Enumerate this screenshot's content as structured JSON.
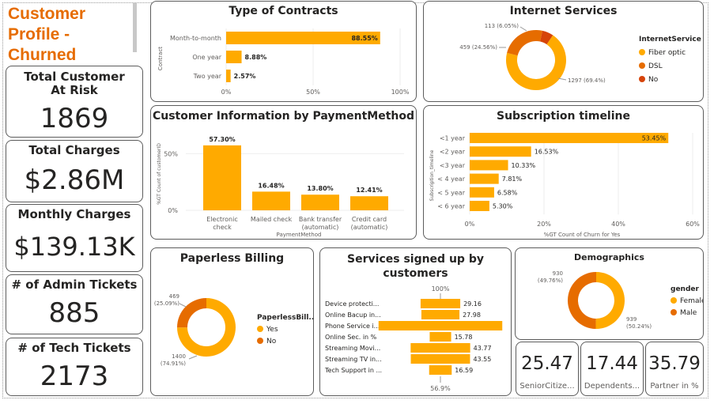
{
  "page": {
    "title": "Customer Profile - Churned"
  },
  "kpis": [
    {
      "label": "Total Customer At Risk",
      "value": "1869"
    },
    {
      "label": "Total Charges",
      "value": "$2.86M"
    },
    {
      "label": "Monthly Charges",
      "value": "$139.13K"
    },
    {
      "label": "# of Admin Tickets",
      "value": "885"
    },
    {
      "label": "# of Tech Tickets",
      "value": "2173"
    }
  ],
  "colors": {
    "primary": "#FFAA00",
    "secondary": "#E66C00",
    "tertiary": "#D64409",
    "title": "#E66C00"
  },
  "chart_data": [
    {
      "id": "contracts",
      "type": "bar",
      "orientation": "horizontal",
      "title": "Type of Contracts",
      "ylabel": "Contract",
      "xlabel": "",
      "categories": [
        "Month-to-month",
        "One year",
        "Two year"
      ],
      "values": [
        88.55,
        8.88,
        2.57
      ],
      "value_labels": [
        "88.55%",
        "8.88%",
        "2.57%"
      ],
      "xlim": [
        0,
        100
      ],
      "xticks": [
        "0%",
        "50%",
        "100%"
      ]
    },
    {
      "id": "internet",
      "type": "pie",
      "donut": true,
      "title": "Internet Services",
      "legend_title": "InternetService",
      "categories": [
        "Fiber optic",
        "DSL",
        "No"
      ],
      "values": [
        1297,
        459,
        113
      ],
      "value_labels": [
        "1297 (69.4%)",
        "459 (24.56%)",
        "113 (6.05%)"
      ]
    },
    {
      "id": "payment",
      "type": "bar",
      "title": "Customer Information by PaymentMethod",
      "ylabel": "%GT Count of customerID",
      "xlabel": "PaymentMethod",
      "categories": [
        "Electronic check",
        "Mailed check",
        "Bank transfer (automatic)",
        "Credit card (automatic)"
      ],
      "values": [
        57.3,
        16.48,
        13.8,
        12.41
      ],
      "value_labels": [
        "57.30%",
        "16.48%",
        "13.80%",
        "12.41%"
      ],
      "ylim": [
        0,
        60
      ],
      "yticks": [
        "0%",
        "50%"
      ]
    },
    {
      "id": "subscription",
      "type": "bar",
      "orientation": "horizontal",
      "title": "Subscription timeline",
      "ylabel": "Subscription_timeline",
      "xlabel": "%GT Count of Churn for Yes",
      "categories": [
        "<1 year",
        "<2 year",
        "<3 year",
        "< 4 year",
        "< 5 year",
        "< 6 year"
      ],
      "values": [
        53.45,
        16.53,
        10.33,
        7.81,
        6.58,
        5.3
      ],
      "value_labels": [
        "53.45%",
        "16.53%",
        "10.33%",
        "7.81%",
        "6.58%",
        "5.30%"
      ],
      "xlim": [
        0,
        60
      ],
      "xticks": [
        "0%",
        "20%",
        "40%",
        "60%"
      ]
    },
    {
      "id": "paperless",
      "type": "pie",
      "donut": true,
      "title": "Paperless Billing",
      "legend_title": "PaperlessBill...",
      "categories": [
        "Yes",
        "No"
      ],
      "values": [
        1400,
        469
      ],
      "value_labels": [
        "1400 (74.91%)",
        "469 (25.09%)"
      ]
    },
    {
      "id": "services",
      "type": "bar",
      "orientation": "horizontal",
      "style": "funnel",
      "title": "Services signed up by customers",
      "categories": [
        "Device protecti...",
        "Online Bacup in...",
        "Phone Service i...",
        "Online Sec. in %",
        "Streaming Movi...",
        "Streaming TV in...",
        "Tech Support in ..."
      ],
      "values": [
        29.16,
        27.98,
        90.97,
        15.78,
        43.77,
        43.55,
        16.59
      ],
      "value_labels": [
        "29.16",
        "27.98",
        "",
        "15.78",
        "43.77",
        "43.55",
        "16.59"
      ],
      "top_label": "100%",
      "bottom_label": "56.9%"
    },
    {
      "id": "demographics",
      "type": "pie",
      "donut": true,
      "title": "Demographics",
      "legend_title": "gender",
      "categories": [
        "Female",
        "Male"
      ],
      "values": [
        939,
        930
      ],
      "value_labels": [
        "939 (50.24%)",
        "930 (49.76%)"
      ]
    }
  ],
  "mini_kpis": [
    {
      "value": "25.47",
      "label": "SeniorCitize..."
    },
    {
      "value": "17.44",
      "label": "Dependents..."
    },
    {
      "value": "35.79",
      "label": "Partner in %"
    }
  ]
}
